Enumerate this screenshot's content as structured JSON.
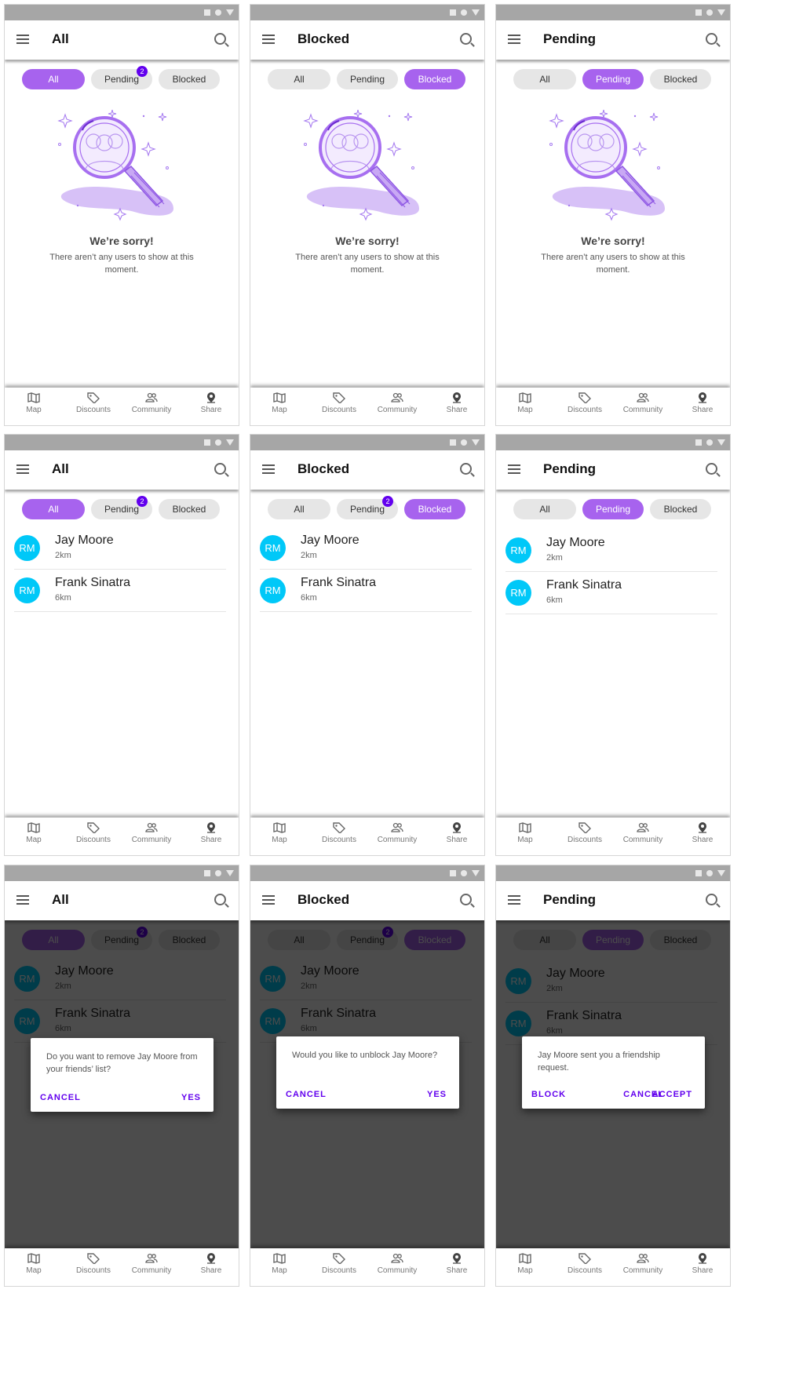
{
  "screens": [
    {
      "title": "All",
      "chips": [
        "All",
        "Pending",
        "Blocked"
      ],
      "active": 0,
      "badge": "2",
      "empty": {
        "title": "We’re sorry!",
        "message": "There aren’t any users to show at this moment."
      }
    },
    {
      "title": "Blocked",
      "chips": [
        "All",
        "Pending",
        "Blocked"
      ],
      "active": 2,
      "empty": {
        "title": "We’re sorry!",
        "message": "There aren’t any users to show at this moment."
      }
    },
    {
      "title": "Pending",
      "chips": [
        "All",
        "Pending",
        "Blocked"
      ],
      "active": 1,
      "empty": {
        "title": "We’re sorry!",
        "message": "There aren’t any users to show at this moment."
      }
    },
    {
      "title": "All",
      "chips": [
        "All",
        "Pending",
        "Blocked"
      ],
      "active": 0,
      "badge": "2",
      "users": [
        {
          "initials": "RM",
          "name": "Jay Moore",
          "distance": "2km"
        },
        {
          "initials": "RM",
          "name": "Frank Sinatra",
          "distance": "6km"
        }
      ]
    },
    {
      "title": "Blocked",
      "chips": [
        "All",
        "Pending",
        "Blocked"
      ],
      "active": 2,
      "badge": "2",
      "users": [
        {
          "initials": "RM",
          "name": "Jay Moore",
          "distance": "2km"
        },
        {
          "initials": "RM",
          "name": "Frank Sinatra",
          "distance": "6km"
        }
      ]
    },
    {
      "title": "Pending",
      "chips": [
        "All",
        "Pending",
        "Blocked"
      ],
      "active": 1,
      "users": [
        {
          "initials": "RM",
          "name": "Jay Moore",
          "distance": "2km"
        },
        {
          "initials": "RM",
          "name": "Frank Sinatra",
          "distance": "6km"
        }
      ]
    },
    {
      "title": "All",
      "chips": [
        "All",
        "Pending",
        "Blocked"
      ],
      "active": 0,
      "badge": "2",
      "users": [
        {
          "initials": "RM",
          "name": "Jay Moore",
          "distance": "2km"
        },
        {
          "initials": "RM",
          "name": "Frank Sinatra",
          "distance": "6km"
        }
      ],
      "dialog": {
        "text": "Do you want to remove Jay Moore from your friends’ list?",
        "left_button": "CANCEL",
        "right_buttons": [
          "YES"
        ]
      }
    },
    {
      "title": "Blocked",
      "chips": [
        "All",
        "Pending",
        "Blocked"
      ],
      "active": 2,
      "badge": "2",
      "users": [
        {
          "initials": "RM",
          "name": "Jay Moore",
          "distance": "2km"
        },
        {
          "initials": "RM",
          "name": "Frank Sinatra",
          "distance": "6km"
        }
      ],
      "dialog": {
        "text": "Would you like to unblock Jay Moore?",
        "left_button": "CANCEL",
        "right_buttons": [
          "YES"
        ]
      }
    },
    {
      "title": "Pending",
      "chips": [
        "All",
        "Pending",
        "Blocked"
      ],
      "active": 1,
      "users": [
        {
          "initials": "RM",
          "name": "Jay Moore",
          "distance": "2km"
        },
        {
          "initials": "RM",
          "name": "Frank Sinatra",
          "distance": "6km"
        }
      ],
      "dialog": {
        "text": "Jay Moore sent you a friendship request.",
        "left_button": "BLOCK",
        "right_buttons": [
          "CANCEL",
          "ACCEPT"
        ]
      }
    }
  ],
  "nav": [
    {
      "label": "Map",
      "icon": "map-icon"
    },
    {
      "label": "Discounts",
      "icon": "tag-icon"
    },
    {
      "label": "Community",
      "icon": "community-icon"
    },
    {
      "label": "Share",
      "icon": "location-pin-icon"
    }
  ],
  "colors": {
    "accent": "#a763ee",
    "badge": "#6200ee",
    "avatar": "#00c8f8",
    "dialog_button": "#6200ee"
  }
}
